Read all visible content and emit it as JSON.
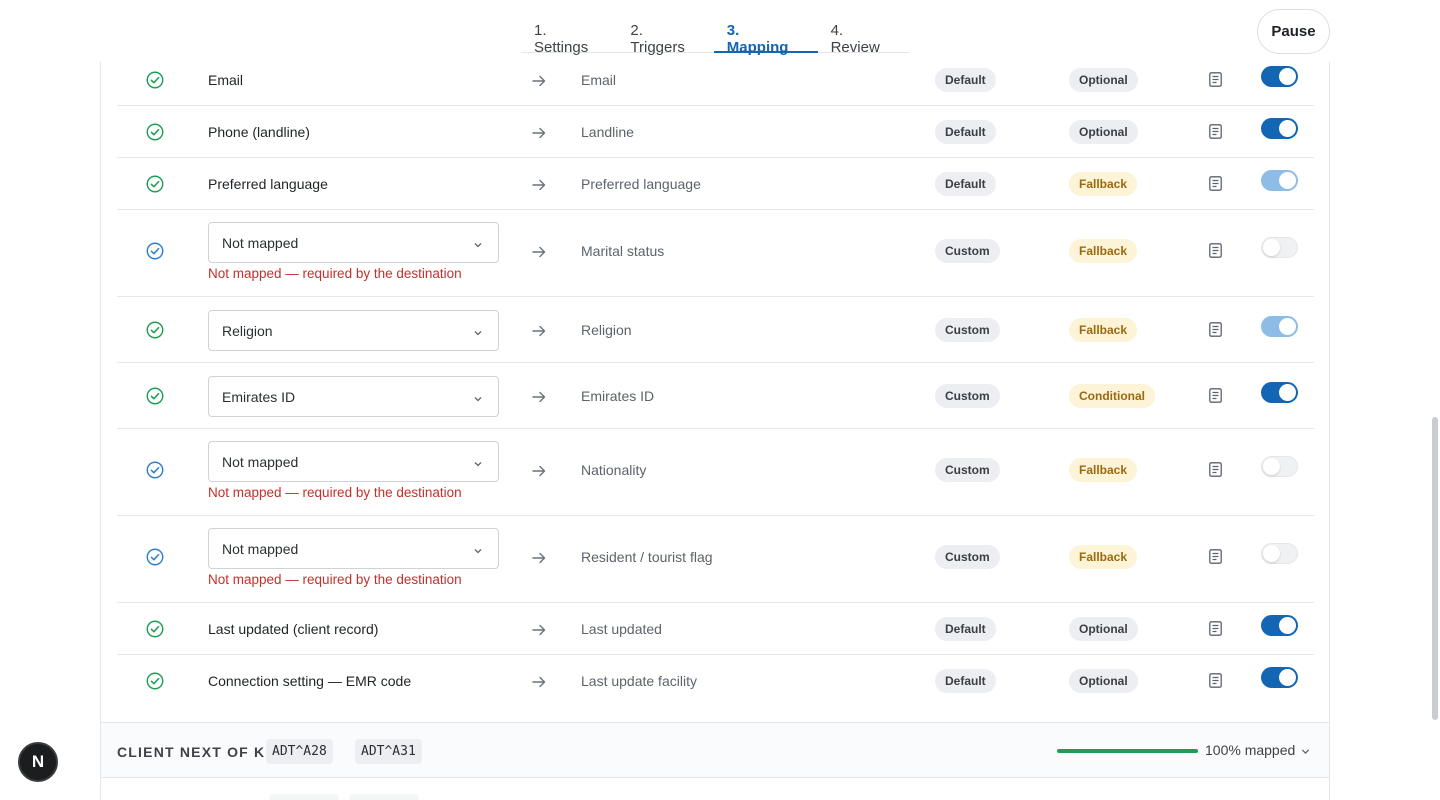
{
  "tabs": [
    {
      "label": "1. Settings",
      "active": false
    },
    {
      "label": "2. Triggers",
      "active": false
    },
    {
      "label": "3. Mapping",
      "active": true
    },
    {
      "label": "4. Review",
      "active": false
    }
  ],
  "pause_label": "Pause",
  "rows": [
    {
      "status": "mapped",
      "source": "Email",
      "dest": "Email",
      "type": "Default",
      "requirement": "Optional",
      "toggle": "on"
    },
    {
      "status": "mapped",
      "source": "Phone (landline)",
      "dest": "Landline",
      "type": "Default",
      "requirement": "Optional",
      "toggle": "on"
    },
    {
      "status": "mapped",
      "source": "Preferred language",
      "dest": "Preferred language",
      "type": "Default",
      "requirement": "Fallback",
      "toggle": "on-dim"
    },
    {
      "status": "unmapped",
      "select": "Not mapped",
      "error": "Not mapped — required by the destination",
      "dest": "Marital status",
      "type": "Custom",
      "requirement": "Fallback",
      "toggle": "off"
    },
    {
      "status": "mapped",
      "select": "Religion",
      "dest": "Religion",
      "type": "Custom",
      "requirement": "Fallback",
      "toggle": "on-dim"
    },
    {
      "status": "mapped",
      "select": "Emirates ID",
      "dest": "Emirates ID",
      "type": "Custom",
      "requirement": "Conditional",
      "toggle": "on"
    },
    {
      "status": "unmapped",
      "select": "Not mapped",
      "error": "Not mapped — required by the destination",
      "dest": "Nationality",
      "type": "Custom",
      "requirement": "Fallback",
      "toggle": "off"
    },
    {
      "status": "unmapped",
      "select": "Not mapped",
      "error": "Not mapped — required by the destination",
      "dest": "Resident / tourist flag",
      "type": "Custom",
      "requirement": "Fallback",
      "toggle": "off"
    },
    {
      "status": "mapped",
      "source": "Last updated (client record)",
      "dest": "Last updated",
      "type": "Default",
      "requirement": "Optional",
      "toggle": "on"
    },
    {
      "status": "mapped",
      "source": "Connection setting — EMR code",
      "dest": "Last update facility",
      "type": "Default",
      "requirement": "Optional",
      "toggle": "on"
    }
  ],
  "section": {
    "title": "CLIENT NEXT OF KIN",
    "codes": [
      "ADT^A28",
      "ADT^A31"
    ],
    "progress_fraction": 1.0,
    "progress_label": "100% mapped"
  },
  "badge_letter": "N",
  "colors": {
    "accent": "#1366b3",
    "success": "#1f9d55",
    "error": "#c4302b",
    "warning_bg": "#fdf3d7",
    "warning_text": "#9a6a10"
  }
}
